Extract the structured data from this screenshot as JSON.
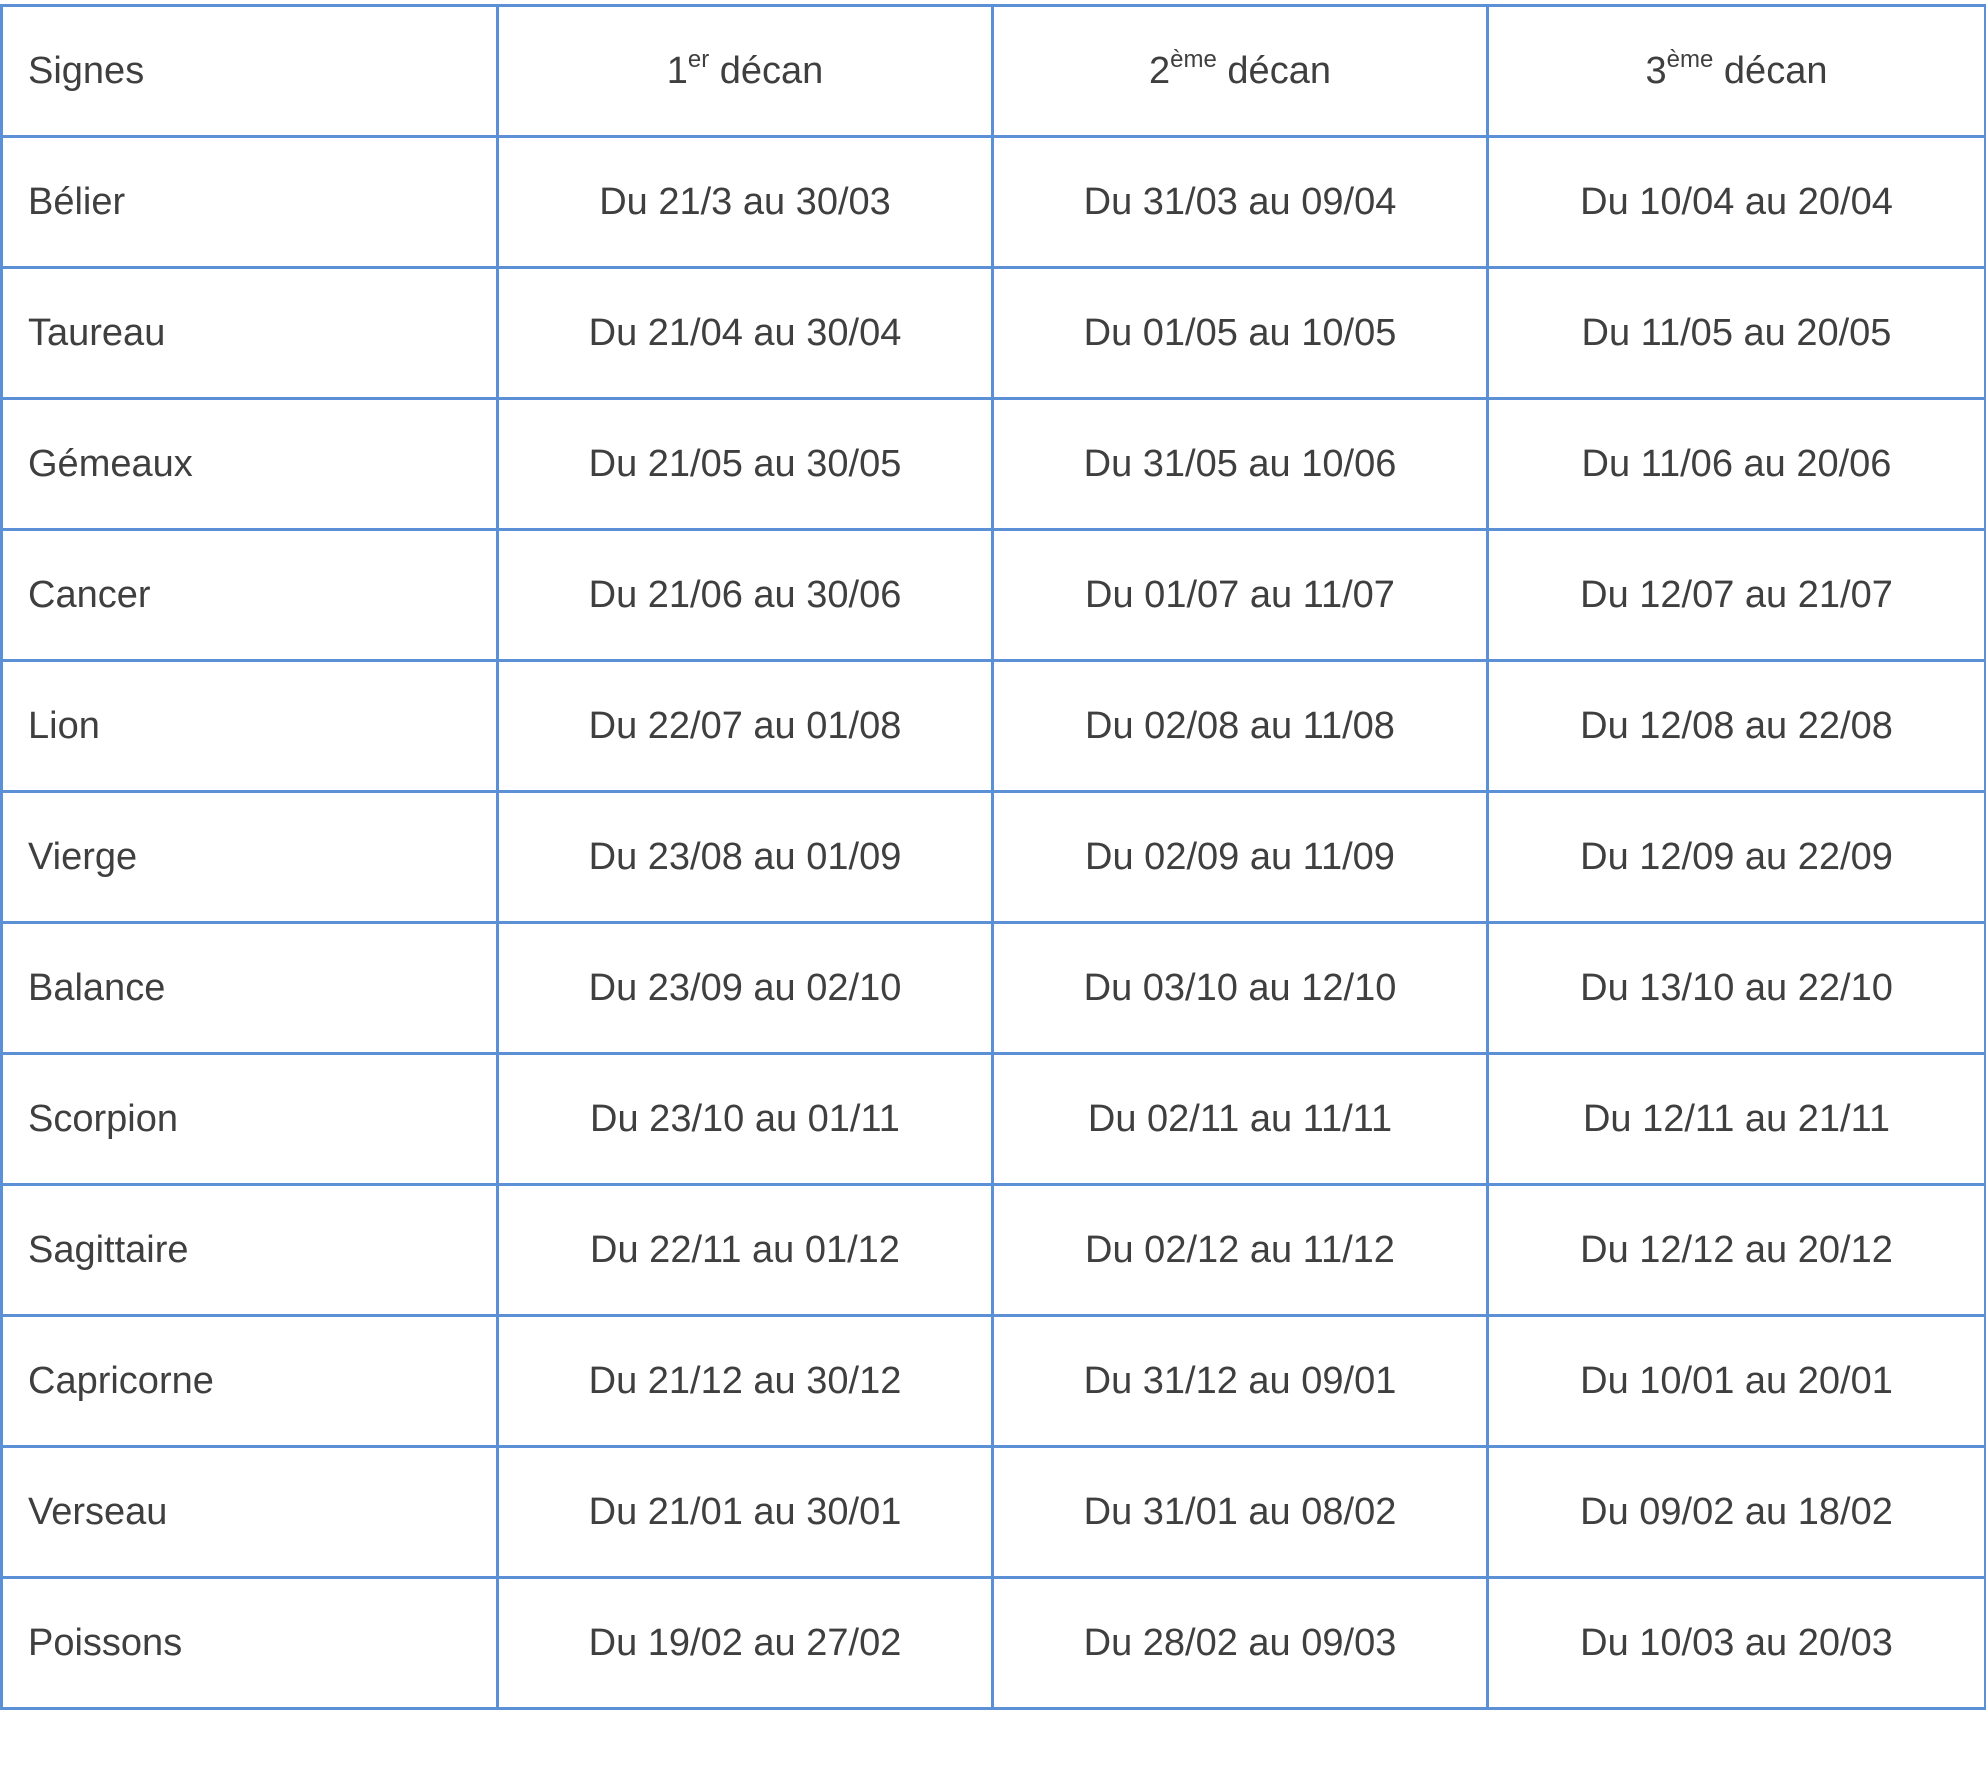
{
  "header": {
    "sign": "Signes",
    "decans": [
      {
        "num": "1",
        "sup": "er",
        "word": "décan"
      },
      {
        "num": "2",
        "sup": "ème",
        "word": "décan"
      },
      {
        "num": "3",
        "sup": "ème",
        "word": "décan"
      }
    ]
  },
  "rows": [
    {
      "sign": "Bélier",
      "d1": "Du 21/3 au 30/03",
      "d2": "Du 31/03 au 09/04",
      "d3": "Du 10/04 au 20/04"
    },
    {
      "sign": "Taureau",
      "d1": "Du 21/04 au 30/04",
      "d2": "Du 01/05 au 10/05",
      "d3": "Du 11/05 au 20/05"
    },
    {
      "sign": "Gémeaux",
      "d1": "Du 21/05 au 30/05",
      "d2": "Du 31/05 au 10/06",
      "d3": "Du 11/06 au 20/06"
    },
    {
      "sign": "Cancer",
      "d1": "Du 21/06 au 30/06",
      "d2": "Du 01/07 au 11/07",
      "d3": "Du 12/07 au 21/07"
    },
    {
      "sign": "Lion",
      "d1": "Du 22/07 au 01/08",
      "d2": "Du 02/08 au 11/08",
      "d3": "Du 12/08 au 22/08"
    },
    {
      "sign": "Vierge",
      "d1": "Du 23/08 au 01/09",
      "d2": "Du 02/09 au 11/09",
      "d3": "Du 12/09 au 22/09"
    },
    {
      "sign": "Balance",
      "d1": "Du 23/09 au 02/10",
      "d2": "Du 03/10 au 12/10",
      "d3": "Du 13/10 au 22/10"
    },
    {
      "sign": "Scorpion",
      "d1": "Du 23/10 au 01/11",
      "d2": "Du 02/11 au 11/11",
      "d3": "Du 12/11 au 21/11"
    },
    {
      "sign": "Sagittaire",
      "d1": "Du 22/11 au 01/12",
      "d2": "Du 02/12 au 11/12",
      "d3": "Du 12/12 au 20/12"
    },
    {
      "sign": "Capricorne",
      "d1": "Du 21/12 au 30/12",
      "d2": "Du 31/12 au 09/01",
      "d3": "Du 10/01 au 20/01"
    },
    {
      "sign": "Verseau",
      "d1": "Du 21/01 au 30/01",
      "d2": "Du 31/01 au 08/02",
      "d3": "Du 09/02 au 18/02"
    },
    {
      "sign": "Poissons",
      "d1": "Du 19/02 au 27/02",
      "d2": "Du 28/02 au 09/03",
      "d3": "Du 10/03 au 20/03"
    }
  ],
  "colors": {
    "border": "#5b8fd6",
    "text": "#3f3f3f"
  }
}
